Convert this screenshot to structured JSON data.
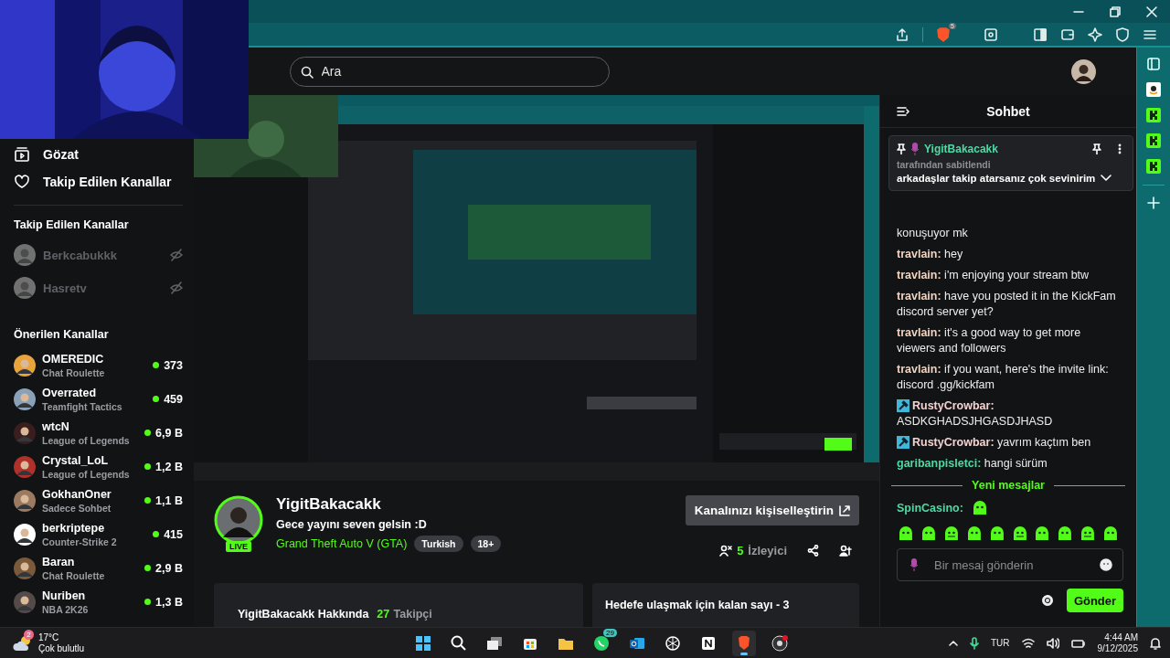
{
  "browser": {
    "brave_badge": "5"
  },
  "header": {
    "search": {
      "placeholder": "Ara"
    }
  },
  "sidebar": {
    "nav": [
      {
        "label": "Gözat"
      },
      {
        "label": "Takip Edilen Kanallar"
      }
    ],
    "followed": {
      "title": "Takip Edilen Kanallar",
      "channels": [
        {
          "name": "Berkcabukkk",
          "live": false
        },
        {
          "name": "Hasretv",
          "live": false
        }
      ]
    },
    "recommended": {
      "title": "Önerilen Kanallar",
      "channels": [
        {
          "name": "OMEREDIC",
          "category": "Chat Roulette",
          "viewers": "373"
        },
        {
          "name": "Overrated",
          "category": "Teamfight Tactics",
          "viewers": "459"
        },
        {
          "name": "wtcN",
          "category": "League of Legends",
          "viewers": "6,9 B"
        },
        {
          "name": "Crystal_LoL",
          "category": "League of Legends",
          "viewers": "1,2 B"
        },
        {
          "name": "GokhanOner",
          "category": "Sadece Sohbet",
          "viewers": "1,1 B"
        },
        {
          "name": "berkriptepe",
          "category": "Counter-Strike 2",
          "viewers": "415"
        },
        {
          "name": "Baran",
          "category": "Chat Roulette",
          "viewers": "2,9 B"
        },
        {
          "name": "Nuriben",
          "category": "NBA 2K26",
          "viewers": "1,3 B"
        }
      ]
    }
  },
  "stream": {
    "channel": "YigitBakacakk",
    "live_badge": "LIVE",
    "title": "Gece yayını seven gelsin :D",
    "category": "Grand Theft Auto V (GTA)",
    "tags": [
      "Turkish",
      "18+"
    ],
    "customize_button": "Kanalınızı kişiselleştirin",
    "viewers_count": "5",
    "viewers_label": "İzleyici"
  },
  "about": {
    "title": "YigitBakacakk Hakkında",
    "followers_count": "27",
    "followers_label": "Takipçi"
  },
  "goal": {
    "title": "Hedefe ulaşmak için kalan sayı - 3"
  },
  "chat": {
    "title": "Sohbet",
    "pinned": {
      "user": "YigitBakacakk",
      "by": "tarafından sabitlendi",
      "text": "arkadaşlar takip atarsanız çok sevinirim"
    },
    "messages": [
      {
        "text": "konuşuyor mk"
      },
      {
        "user": "travlain:",
        "color": "#f1d3be",
        "moderator": false,
        "text": "hey"
      },
      {
        "user": "travlain:",
        "color": "#f1d3be",
        "moderator": false,
        "text": "i'm enjoying your stream btw"
      },
      {
        "user": "travlain:",
        "color": "#f1d3be",
        "moderator": false,
        "text": "have you posted it in the KickFam discord server yet?"
      },
      {
        "user": "travlain:",
        "color": "#f1d3be",
        "moderator": false,
        "text": "it's a good way to get more viewers and followers"
      },
      {
        "user": "travlain:",
        "color": "#f1d3be",
        "moderator": false,
        "text": "if you want, here's the invite link: discord .gg/kickfam"
      },
      {
        "user": "RustyCrowbar:",
        "color": "#f4d2d2",
        "moderator": true,
        "text": "ASDKGHADSJHGASDJHASD"
      },
      {
        "user": "RustyCrowbar:",
        "color": "#f4d2d2",
        "moderator": true,
        "text": "yavrım kaçtım ben"
      },
      {
        "user": "garibanpisletci:",
        "color": "#4fd8a4",
        "moderator": false,
        "text": "hangi sürüm"
      }
    ],
    "new_messages": "Yeni mesajlar",
    "new": [
      {
        "user": "SpinCasino:",
        "color": "#4fd8a4",
        "kind": "emote"
      }
    ],
    "input": {
      "placeholder": "Bir mesaj gönderin"
    },
    "send_button": "Gönder"
  },
  "taskbar": {
    "weather": {
      "badge": "2",
      "temp": "17°C",
      "desc": "Çok bulutlu"
    },
    "apps": [
      {
        "kind": "windows",
        "active": false
      },
      {
        "kind": "search",
        "active": false
      },
      {
        "kind": "taskview",
        "active": false
      },
      {
        "kind": "store",
        "active": false
      },
      {
        "kind": "folder",
        "active": false
      },
      {
        "kind": "chat",
        "active": false,
        "badge": "29"
      },
      {
        "kind": "mail",
        "active": false
      },
      {
        "kind": "knot",
        "active": false
      },
      {
        "kind": "notes",
        "active": false
      },
      {
        "kind": "lion",
        "active": true
      },
      {
        "kind": "record",
        "active": false
      }
    ],
    "language": "TUR",
    "time": "4:44 AM",
    "date": "9/12/2025"
  }
}
